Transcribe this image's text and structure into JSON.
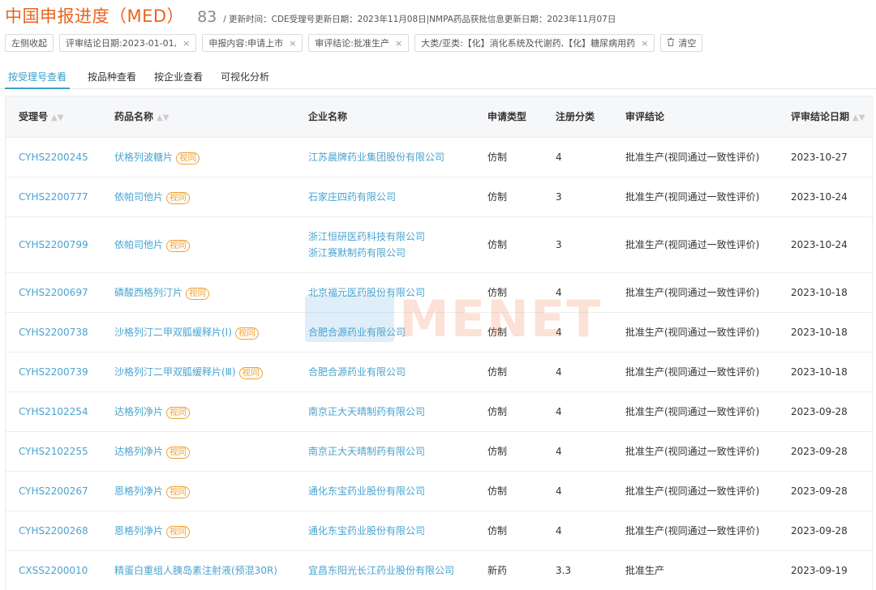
{
  "header": {
    "title": "中国申报进度（MED）",
    "count": "83",
    "update_info": "/ 更新时间：CDE受理号更新日期：2023年11月08日|NMPA药品获批信息更新日期：2023年11月07日"
  },
  "filters": {
    "collapse_label": "左侧收起",
    "chips": [
      {
        "label": "评审结论日期:2023-01-01,"
      },
      {
        "label": "申报内容:申请上市"
      },
      {
        "label": "审评结论:批准生产"
      },
      {
        "label": "大类/亚类:【化】消化系统及代谢药,【化】糖尿病用药"
      }
    ],
    "close_glyph": "×",
    "clear_label": "清空"
  },
  "tabs": [
    "按受理号查看",
    "按品种查看",
    "按企业查看",
    "可视化分析"
  ],
  "table": {
    "columns": [
      "受理号",
      "药品名称",
      "企业名称",
      "申请类型",
      "注册分类",
      "审评结论",
      "评审结论日期"
    ],
    "badge_text": "视同",
    "rows": [
      {
        "id": "CYHS2200245",
        "drug": "伏格列波糖片",
        "badge": true,
        "company": [
          "江苏晨牌药业集团股份有限公司"
        ],
        "type": "仿制",
        "class": "4",
        "conclusion": "批准生产(视同通过一致性评价)",
        "date": "2023-10-27"
      },
      {
        "id": "CYHS2200777",
        "drug": "依帕司他片",
        "badge": true,
        "company": [
          "石家庄四药有限公司"
        ],
        "type": "仿制",
        "class": "3",
        "conclusion": "批准生产(视同通过一致性评价)",
        "date": "2023-10-24"
      },
      {
        "id": "CYHS2200799",
        "drug": "依帕司他片",
        "badge": true,
        "company": [
          "浙江恒研医药科技有限公司",
          "浙江赛默制药有限公司"
        ],
        "type": "仿制",
        "class": "3",
        "conclusion": "批准生产(视同通过一致性评价)",
        "date": "2023-10-24"
      },
      {
        "id": "CYHS2200697",
        "drug": "磷酸西格列汀片",
        "badge": true,
        "company": [
          "北京福元医药股份有限公司"
        ],
        "type": "仿制",
        "class": "4",
        "conclusion": "批准生产(视同通过一致性评价)",
        "date": "2023-10-18"
      },
      {
        "id": "CYHS2200738",
        "drug": "沙格列汀二甲双胍缓释片(Ⅰ)",
        "badge": true,
        "company": [
          "合肥合源药业有限公司"
        ],
        "type": "仿制",
        "class": "4",
        "conclusion": "批准生产(视同通过一致性评价)",
        "date": "2023-10-18"
      },
      {
        "id": "CYHS2200739",
        "drug": "沙格列汀二甲双胍缓释片(Ⅲ)",
        "badge": true,
        "company": [
          "合肥合源药业有限公司"
        ],
        "type": "仿制",
        "class": "4",
        "conclusion": "批准生产(视同通过一致性评价)",
        "date": "2023-10-18"
      },
      {
        "id": "CYHS2102254",
        "drug": "达格列净片",
        "badge": true,
        "company": [
          "南京正大天晴制药有限公司"
        ],
        "type": "仿制",
        "class": "4",
        "conclusion": "批准生产(视同通过一致性评价)",
        "date": "2023-09-28"
      },
      {
        "id": "CYHS2102255",
        "drug": "达格列净片",
        "badge": true,
        "company": [
          "南京正大天晴制药有限公司"
        ],
        "type": "仿制",
        "class": "4",
        "conclusion": "批准生产(视同通过一致性评价)",
        "date": "2023-09-28"
      },
      {
        "id": "CYHS2200267",
        "drug": "恩格列净片",
        "badge": true,
        "company": [
          "通化东宝药业股份有限公司"
        ],
        "type": "仿制",
        "class": "4",
        "conclusion": "批准生产(视同通过一致性评价)",
        "date": "2023-09-28"
      },
      {
        "id": "CYHS2200268",
        "drug": "恩格列净片",
        "badge": true,
        "company": [
          "通化东宝药业股份有限公司"
        ],
        "type": "仿制",
        "class": "4",
        "conclusion": "批准生产(视同通过一致性评价)",
        "date": "2023-09-28"
      },
      {
        "id": "CXSS2200010",
        "drug": "精蛋白重组人胰岛素注射液(预混30R)",
        "badge": false,
        "company": [
          "宜昌东阳光长江药业股份有限公司"
        ],
        "type": "新药",
        "class": "3.3",
        "conclusion": "批准生产",
        "date": "2023-09-19"
      }
    ]
  },
  "watermark": {
    "text": "MENET"
  },
  "colors": {
    "accent": "#e8641c",
    "link": "#4aa3cf",
    "badge": "#f0a030",
    "tab_active": "#3aa0c8"
  }
}
